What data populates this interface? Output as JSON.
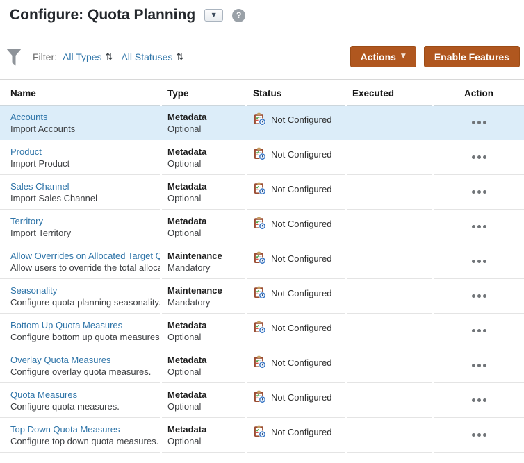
{
  "header": {
    "title": "Configure: Quota Planning",
    "help_label": "?"
  },
  "icons": {
    "caret_down": "▼",
    "sort_toggle": "⇅"
  },
  "toolbar": {
    "filter_label": "Filter:",
    "filters": [
      {
        "label": "All Types"
      },
      {
        "label": "All Statuses"
      }
    ],
    "actions_button": "Actions",
    "enable_features_button": "Enable Features"
  },
  "table": {
    "columns": [
      "Name",
      "Type",
      "Status",
      "Executed",
      "Action"
    ],
    "rows": [
      {
        "name": "Accounts",
        "description": "Import Accounts",
        "type": "Metadata",
        "requirement": "Optional",
        "status": "Not Configured",
        "executed": "",
        "selected": true
      },
      {
        "name": "Product",
        "description": "Import Product",
        "type": "Metadata",
        "requirement": "Optional",
        "status": "Not Configured",
        "executed": "",
        "selected": false
      },
      {
        "name": "Sales Channel",
        "description": "Import Sales Channel",
        "type": "Metadata",
        "requirement": "Optional",
        "status": "Not Configured",
        "executed": "",
        "selected": false
      },
      {
        "name": "Territory",
        "description": "Import Territory",
        "type": "Metadata",
        "requirement": "Optional",
        "status": "Not Configured",
        "executed": "",
        "selected": false
      },
      {
        "name": "Allow Overrides on Allocated Target Q",
        "description": "Allow users to override the total alloca",
        "type": "Maintenance",
        "requirement": "Mandatory",
        "status": "Not Configured",
        "executed": "",
        "selected": false
      },
      {
        "name": "Seasonality",
        "description": "Configure quota planning seasonality.",
        "type": "Maintenance",
        "requirement": "Mandatory",
        "status": "Not Configured",
        "executed": "",
        "selected": false
      },
      {
        "name": "Bottom Up Quota Measures",
        "description": "Configure bottom up quota measures.",
        "type": "Metadata",
        "requirement": "Optional",
        "status": "Not Configured",
        "executed": "",
        "selected": false
      },
      {
        "name": "Overlay Quota Measures",
        "description": "Configure overlay quota measures.",
        "type": "Metadata",
        "requirement": "Optional",
        "status": "Not Configured",
        "executed": "",
        "selected": false
      },
      {
        "name": "Quota Measures",
        "description": "Configure quota measures.",
        "type": "Metadata",
        "requirement": "Optional",
        "status": "Not Configured",
        "executed": "",
        "selected": false
      },
      {
        "name": "Top Down Quota Measures",
        "description": "Configure top down quota measures.",
        "type": "Metadata",
        "requirement": "Optional",
        "status": "Not Configured",
        "executed": "",
        "selected": false
      }
    ]
  },
  "colors": {
    "accent": "#b0571f",
    "link": "#2e74a8",
    "selected-row": "#dcedf9"
  }
}
